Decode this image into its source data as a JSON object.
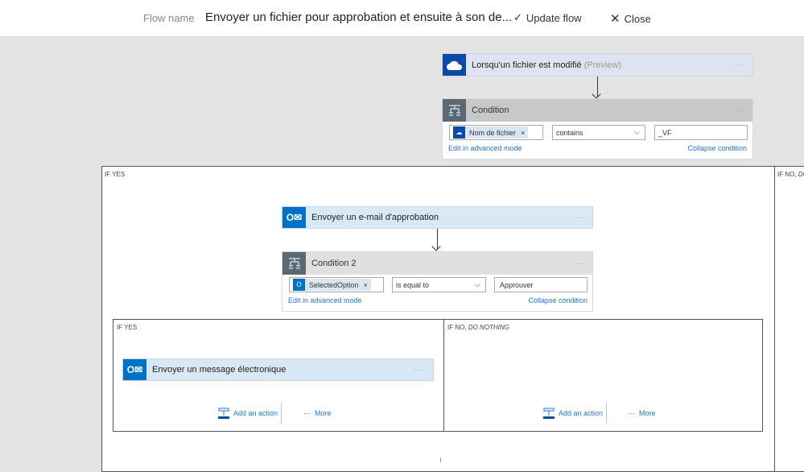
{
  "header": {
    "flow_name_label": "Flow name",
    "flow_name": "Envoyer un fichier pour approbation et ensuite à son de...",
    "update_label": "Update flow",
    "close_label": "Close"
  },
  "trigger": {
    "title": "Lorsqu'un fichier est modifié",
    "suffix": "(Preview)",
    "icon": "onedrive-icon"
  },
  "condition1": {
    "title": "Condition",
    "token": "Nom de fichier",
    "operator": "contains",
    "value": "_VF",
    "edit_link": "Edit in advanced mode",
    "collapse_link": "Collapse condition"
  },
  "branch_yes": {
    "label": "IF YES"
  },
  "branch_no": {
    "label": "IF NO,",
    "label_italic": "DO"
  },
  "approval": {
    "title": "Envoyer un e-mail d'approbation",
    "icon": "outlook-icon"
  },
  "condition2": {
    "title": "Condition 2",
    "token": "SelectedOption",
    "operator": "is equal to",
    "value": "Approuver",
    "edit_link": "Edit in advanced mode",
    "collapse_link": "Collapse condition"
  },
  "inner_yes": {
    "label": "IF YES",
    "action": {
      "title": "Envoyer un message électronique"
    },
    "add_action": "Add an action",
    "more": "More"
  },
  "inner_no": {
    "label": "IF NO,",
    "label_italic": "DO NOTHING",
    "add_action": "Add an action",
    "more": "More"
  },
  "colors": {
    "onedrive": "#0a4aa8",
    "outlook": "#0072c6",
    "link": "#1e74d4"
  }
}
